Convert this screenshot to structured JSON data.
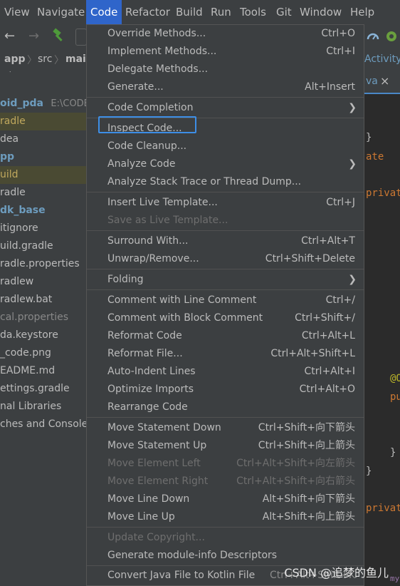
{
  "menubar": {
    "items": [
      {
        "label": "View"
      },
      {
        "label": "Navigate"
      },
      {
        "label": "Code"
      },
      {
        "label": "Refactor"
      },
      {
        "label": "Build"
      },
      {
        "label": "Run"
      },
      {
        "label": "Tools"
      },
      {
        "label": "Git"
      },
      {
        "label": "Window"
      },
      {
        "label": "Help"
      }
    ],
    "active_index": 2
  },
  "navbar": {
    "crumbs": [
      "app",
      "src",
      "mai"
    ],
    "right_fragment": "Activity"
  },
  "editor_tab": {
    "label": "va",
    "close": "×"
  },
  "project_tree": {
    "rows": [
      {
        "label": "oid_pda",
        "path": "E:\\CODE\\"
      },
      {
        "label": "radle"
      },
      {
        "label": "dea"
      },
      {
        "label": "pp"
      },
      {
        "label": "uild"
      },
      {
        "label": "radle"
      },
      {
        "label": "dk_base"
      },
      {
        "label": "itignore"
      },
      {
        "label": "uild.gradle"
      },
      {
        "label": "radle.properties"
      },
      {
        "label": "radlew"
      },
      {
        "label": "radlew.bat"
      },
      {
        "label": "cal.properties"
      },
      {
        "label": "da.keystore"
      },
      {
        "label": "_code.png"
      },
      {
        "label": "EADME.md"
      },
      {
        "label": "ettings.gradle"
      },
      {
        "label": "nal Libraries"
      },
      {
        "label": "ches and Consoles"
      }
    ]
  },
  "editor_code": {
    "lines": [
      "}",
      "ate",
      "privat",
      "@O",
      "pu",
      "}",
      "}",
      "privat",
      "my"
    ]
  },
  "code_menu": {
    "items": [
      {
        "label": "Override Methods...",
        "shortcut": "Ctrl+O"
      },
      {
        "label": "Implement Methods...",
        "shortcut": "Ctrl+I"
      },
      {
        "label": "Delegate Methods...",
        "shortcut": ""
      },
      {
        "label": "Generate...",
        "shortcut": "Alt+Insert"
      },
      {
        "label": "Code Completion",
        "shortcut": "",
        "submenu": true
      },
      {
        "label": "Inspect Code...",
        "shortcut": ""
      },
      {
        "label": "Code Cleanup...",
        "shortcut": ""
      },
      {
        "label": "Analyze Code",
        "shortcut": "",
        "submenu": true
      },
      {
        "label": "Analyze Stack Trace or Thread Dump...",
        "shortcut": ""
      },
      {
        "label": "Insert Live Template...",
        "shortcut": "Ctrl+J"
      },
      {
        "label": "Save as Live Template...",
        "shortcut": "",
        "disabled": true
      },
      {
        "label": "Surround With...",
        "shortcut": "Ctrl+Alt+T"
      },
      {
        "label": "Unwrap/Remove...",
        "shortcut": "Ctrl+Shift+Delete"
      },
      {
        "label": "Folding",
        "shortcut": "",
        "submenu": true
      },
      {
        "label": "Comment with Line Comment",
        "shortcut": "Ctrl+/"
      },
      {
        "label": "Comment with Block Comment",
        "shortcut": "Ctrl+Shift+/"
      },
      {
        "label": "Reformat Code",
        "shortcut": "Ctrl+Alt+L"
      },
      {
        "label": "Reformat File...",
        "shortcut": "Ctrl+Alt+Shift+L"
      },
      {
        "label": "Auto-Indent Lines",
        "shortcut": "Ctrl+Alt+I"
      },
      {
        "label": "Optimize Imports",
        "shortcut": "Ctrl+Alt+O"
      },
      {
        "label": "Rearrange Code",
        "shortcut": ""
      },
      {
        "label": "Move Statement Down",
        "shortcut": "Ctrl+Shift+向下箭头"
      },
      {
        "label": "Move Statement Up",
        "shortcut": "Ctrl+Shift+向上箭头"
      },
      {
        "label": "Move Element Left",
        "shortcut": "Ctrl+Alt+Shift+向左箭头",
        "disabled": true
      },
      {
        "label": "Move Element Right",
        "shortcut": "Ctrl+Alt+Shift+向右箭头",
        "disabled": true
      },
      {
        "label": "Move Line Down",
        "shortcut": "Alt+Shift+向下箭头"
      },
      {
        "label": "Move Line Up",
        "shortcut": "Alt+Shift+向上箭头"
      },
      {
        "label": "Update Copyright...",
        "shortcut": "",
        "disabled": true
      },
      {
        "label": "Generate module-info Descriptors",
        "shortcut": ""
      },
      {
        "label": "Convert Java File to Kotlin File",
        "shortcut": "Ctrl+Alt+Shift+K"
      }
    ]
  },
  "watermark": "CSDN @追梦的鱼儿",
  "colors": {
    "menu_bg": "#3c3f41",
    "active_menu": "#2f65ca",
    "focus_outline": "#3d8ee6",
    "disabled_text": "#6e6e6e"
  }
}
